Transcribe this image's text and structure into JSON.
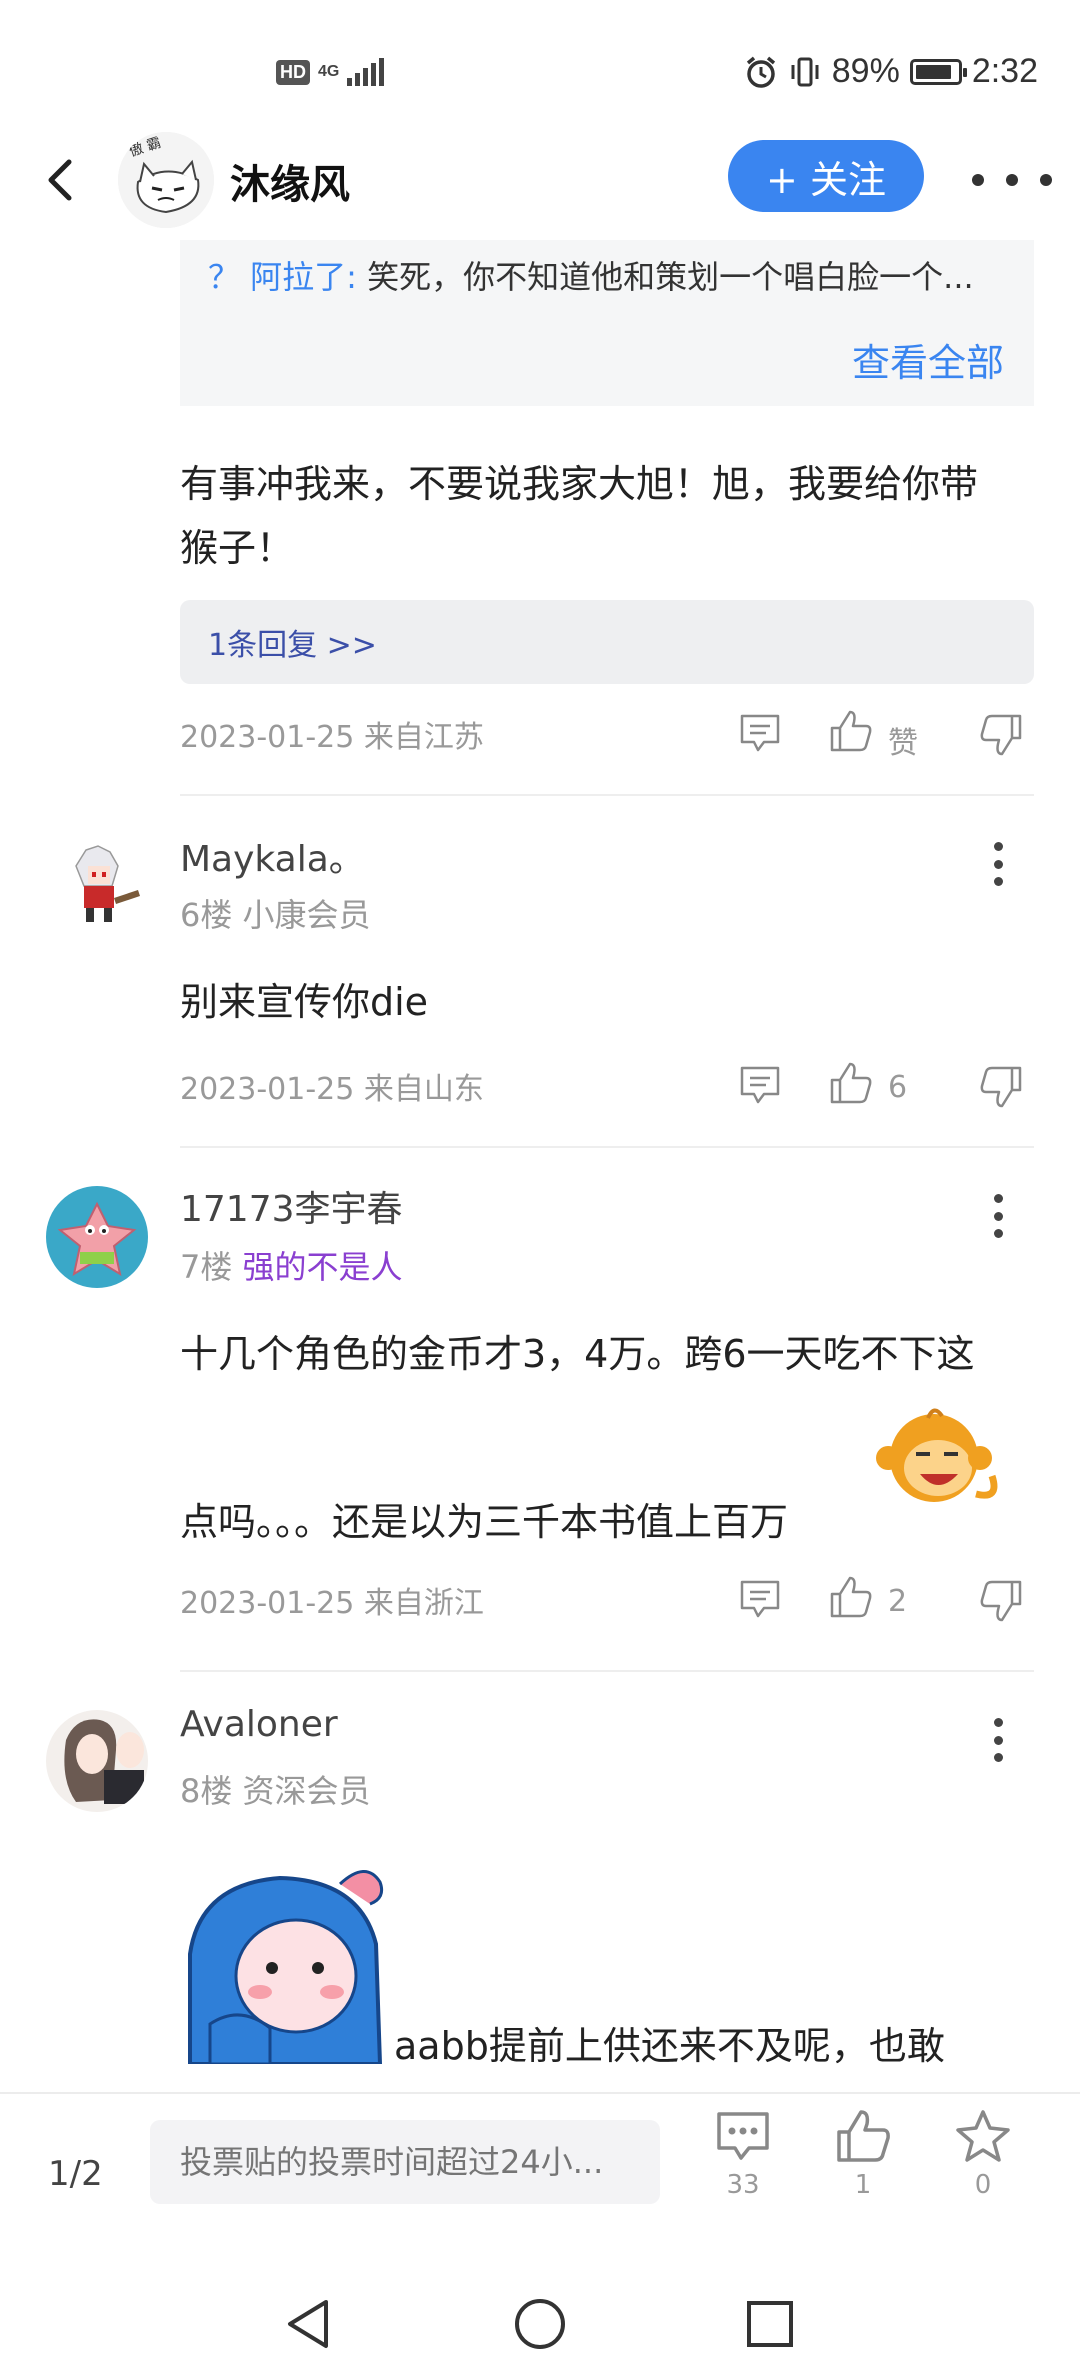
{
  "status_bar": {
    "hd": "HD",
    "network": "4G",
    "battery_percent": "89%",
    "battery_level": 0.89,
    "time": "2:32"
  },
  "header": {
    "user_name": "沐缘风",
    "follow_label": "+ 关注"
  },
  "quote": {
    "user": "？ 阿拉了:",
    "text": " 笑死，你不知道他和策划一个唱白脸一个...",
    "view_all": "查看全部"
  },
  "post5": {
    "line1": "有事冲我来，不要说我家大旭！旭，我要给你带",
    "line2": "猴子！",
    "reply_count": "1条回复 >>",
    "meta": "2023-01-25 来自江苏",
    "like_label": "赞"
  },
  "posts": [
    {
      "username": "Maykala。",
      "floor": "6楼",
      "title": "小康会员",
      "text": "别来宣传你die",
      "meta": "2023-01-25 来自山东",
      "likes": "6"
    },
    {
      "username": "17173李宇春",
      "floor": "7楼",
      "title": "强的不是人",
      "line1": "十几个角色的金币才3，4万。跨6一天吃不下这",
      "line2": "点吗。。。还是以为三千本书值上百万",
      "meta": "2023-01-25 来自浙江",
      "likes": "2"
    },
    {
      "username": "Avaloner",
      "floor": "8楼",
      "title": "资深会员",
      "text": "aabb提前上供还来不及呢，也敢"
    }
  ],
  "bottom_bar": {
    "page": "1/2",
    "input_placeholder": "投票贴的投票时间超过24小...",
    "comments": "33",
    "likes": "1",
    "favorites": "0"
  },
  "colors": {
    "accent": "#3a85f0",
    "purple_title": "#8a3fd0",
    "reply_link": "#3b4fa8"
  }
}
